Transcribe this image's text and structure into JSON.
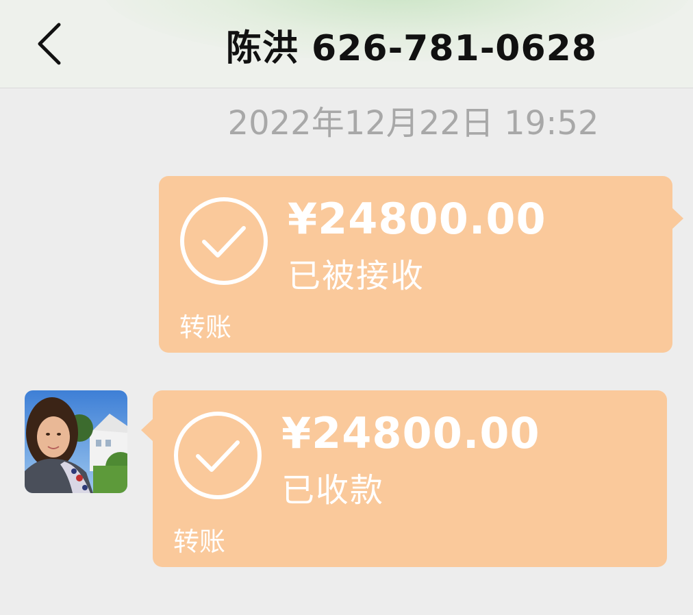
{
  "header": {
    "title": "陈洪 626-781-0628",
    "back_icon": "chevron-left-icon"
  },
  "conversation": {
    "timestamp": "2022年12月22日 19:52",
    "messages": [
      {
        "side": "right",
        "amount": "¥24800.00",
        "status": "已被接收",
        "type_label": "转账",
        "icon": "check-circle-icon"
      },
      {
        "side": "left",
        "amount": "¥24800.00",
        "status": "已收款",
        "type_label": "转账",
        "icon": "check-circle-icon",
        "avatar": "contact-avatar"
      }
    ]
  },
  "colors": {
    "bubble": "#FAC99B",
    "background": "#EDEDED",
    "header_background": "#EEF1EC",
    "timestamp": "#A8A8A8",
    "title": "#111111",
    "bubble_text": "#FFFFFF"
  }
}
